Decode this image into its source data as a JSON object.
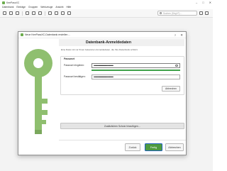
{
  "app": {
    "title": "KeePassXC",
    "window_controls": [
      "–",
      "□",
      "✕"
    ]
  },
  "menubar": {
    "items": [
      "Datenbank",
      "Einträge",
      "Gruppen",
      "Werkzeuge",
      "Ansicht",
      "Hilfe"
    ]
  },
  "toolbar": {
    "search_placeholder": "Suchen (Strg+F)…"
  },
  "dialog": {
    "title": "Neue KeePassXC-Datenbank erstellen…",
    "help": "?",
    "close": "✕",
    "heading": "Datenbank-Anmeldedaten",
    "intro": "Eine Datei mit nur Ihnen bekannten Anmeldedaten, die Ihre Datenbank schützt.",
    "password_group": {
      "legend": "Passwort",
      "enter_label": "Passwort eingeben:",
      "enter_value": "••••••••••••••••••••••••••••",
      "confirm_label": "Passwort bestätigen:",
      "confirm_value": "••••••••••••••••••••••••••••",
      "strength": 1.0,
      "generate_button": "Abbrechen"
    },
    "add_key_button": "Zusätzlichen Schutz hinzufügen…",
    "buttons": {
      "back": "Zurück",
      "finish": "Fertig",
      "cancel": "Abbrechen"
    },
    "colors": {
      "accent_green": "#6cac4d",
      "finish_bg": "#4f9a3f",
      "focus_border": "#1f5fbf",
      "strength": "#3fa14a"
    }
  }
}
